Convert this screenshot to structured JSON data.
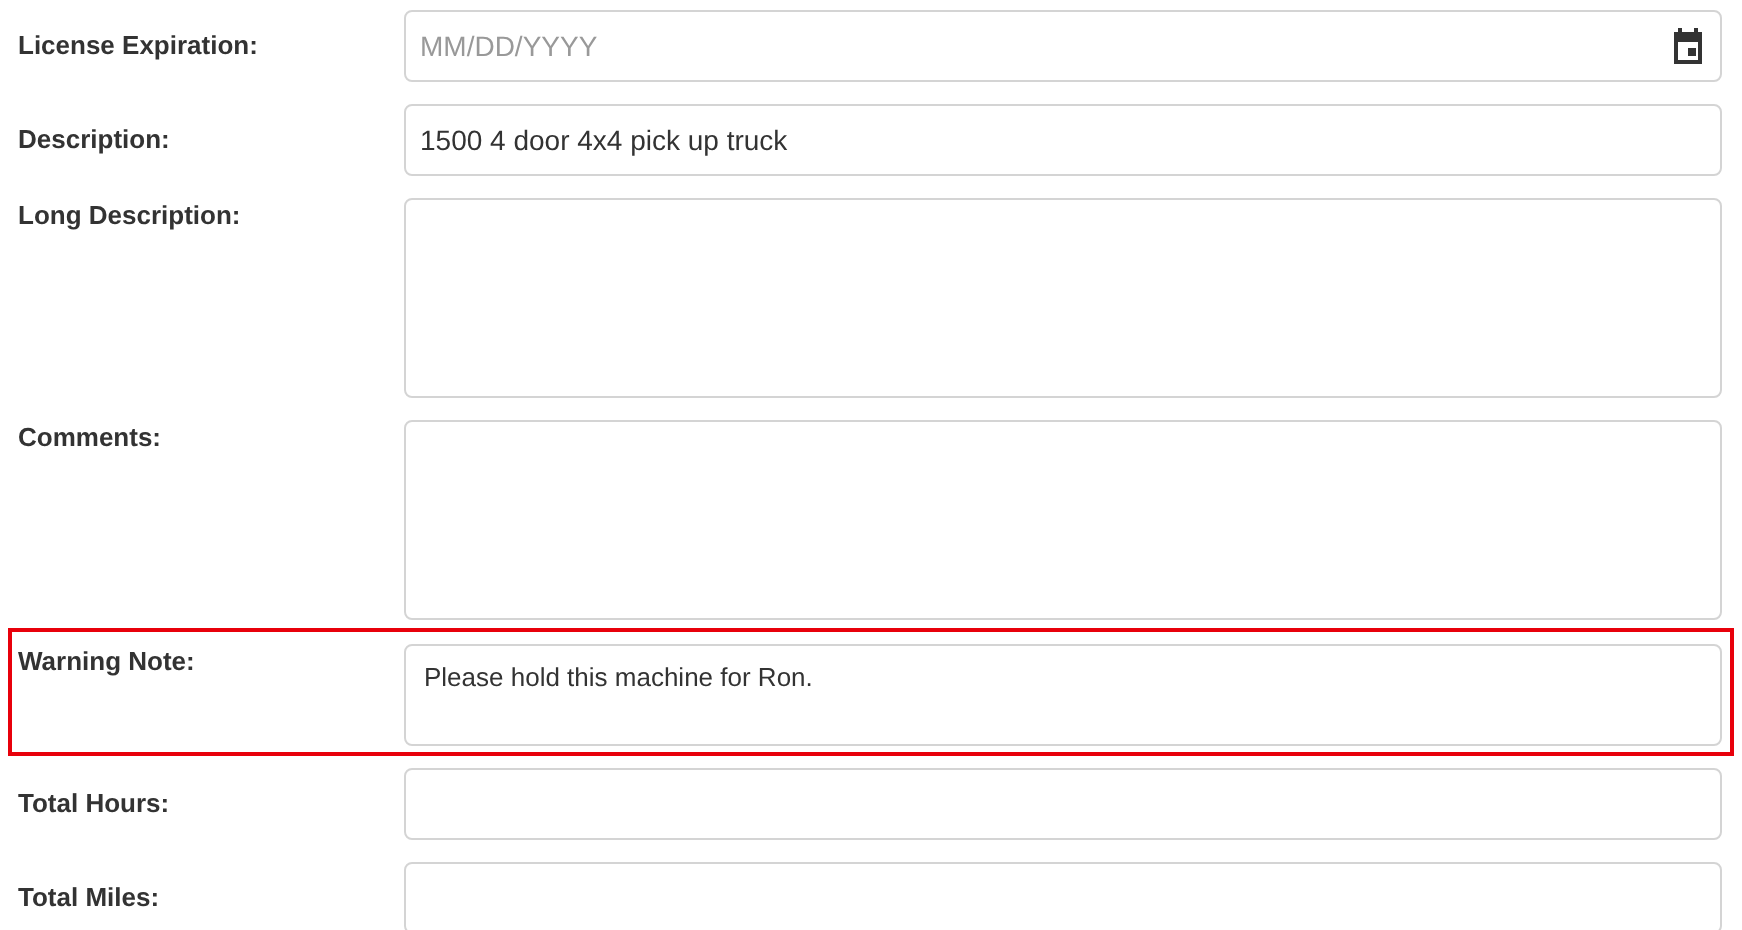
{
  "fields": [
    {
      "label": "License Expiration:",
      "kind": "date",
      "placeholder": "MM/DD/YYYY",
      "flagged": false
    },
    {
      "label": "Description:",
      "kind": "text",
      "value": "1500 4 door 4x4 pick up truck",
      "flagged": false
    },
    {
      "label": "Long Description:",
      "kind": "textarea",
      "flagged": false
    },
    {
      "label": "Comments:",
      "kind": "textarea",
      "flagged": false
    },
    {
      "label": "Warning Note:",
      "kind": "note",
      "value": "Please hold this machine for Ron.",
      "flagged": true
    },
    {
      "label": "Total Hours:",
      "kind": "text",
      "flagged": false
    },
    {
      "label": "Total Miles:",
      "kind": "text",
      "flagged": false
    }
  ]
}
